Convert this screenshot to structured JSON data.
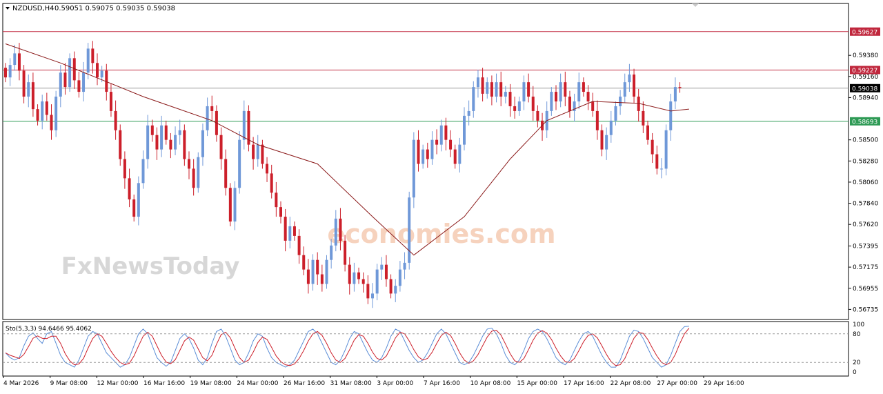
{
  "header": {
    "symbol_label": "NZDUSD,H4",
    "ohlc_label": "0.59051 0.59075 0.59035 0.59038"
  },
  "indicator": {
    "label": "Sto(5,3,3) 94.6466 95.4062",
    "levels": [
      100,
      80,
      20,
      0
    ]
  },
  "watermark": {
    "line1": "economies.com",
    "line2": "FxNewsToday"
  },
  "colors": {
    "bull": "#6f98d8",
    "bear": "#cc1f2a",
    "ma": "#8b1a1a",
    "resistance": "#c0273d",
    "support": "#2e9a55",
    "current": "#9a9a9a",
    "stoch_k": "#5b8dd6",
    "stoch_d": "#cc1f2a",
    "grid": "#000000"
  },
  "chart_data": {
    "type": "candlestick",
    "symbol": "NZDUSD",
    "timeframe": "H4",
    "price_axis_ticks": [
      0.5938,
      0.5916,
      0.5894,
      0.585,
      0.5828,
      0.5806,
      0.5784,
      0.5762,
      0.57395,
      0.57175,
      0.56955,
      0.56735
    ],
    "price_axis_labels": [
      "0.59380",
      "0.59160",
      "0.58940",
      "0.58500",
      "0.58280",
      "0.58060",
      "0.57840",
      "0.57620",
      "0.57395",
      "0.57175",
      "0.56955",
      "0.56735"
    ],
    "ylim": [
      0.5663,
      0.5992
    ],
    "time_axis_labels": [
      "4 Mar 2026",
      "9 Mar 08:00",
      "12 Mar 00:00",
      "16 Mar 16:00",
      "19 Mar 08:00",
      "24 Mar 00:00",
      "26 Mar 16:00",
      "31 Mar 08:00",
      "3 Apr 00:00",
      "7 Apr 16:00",
      "10 Apr 08:00",
      "15 Apr 00:00",
      "17 Apr 16:00",
      "22 Apr 08:00",
      "27 Apr 00:00",
      "29 Apr 16:00"
    ],
    "horizontal_lines": [
      {
        "price": 0.59627,
        "label": "0.59627",
        "role": "resistance"
      },
      {
        "price": 0.59227,
        "label": "0.59227",
        "role": "resistance"
      },
      {
        "price": 0.59038,
        "label": "0.59038",
        "role": "current"
      },
      {
        "price": 0.58693,
        "label": "0.58693",
        "role": "support"
      }
    ],
    "closes": [
      0.5915,
      0.5928,
      0.594,
      0.5922,
      0.5895,
      0.591,
      0.5882,
      0.587,
      0.589,
      0.5876,
      0.586,
      0.5895,
      0.592,
      0.5905,
      0.5935,
      0.5912,
      0.59,
      0.592,
      0.5945,
      0.593,
      0.5915,
      0.5922,
      0.59,
      0.588,
      0.586,
      0.583,
      0.581,
      0.5788,
      0.577,
      0.5805,
      0.583,
      0.5865,
      0.5855,
      0.584,
      0.5865,
      0.585,
      0.584,
      0.5855,
      0.586,
      0.583,
      0.582,
      0.58,
      0.5832,
      0.586,
      0.5885,
      0.588,
      0.5855,
      0.583,
      0.58,
      0.5765,
      0.58,
      0.585,
      0.588,
      0.5845,
      0.583,
      0.5845,
      0.5825,
      0.5815,
      0.5795,
      0.578,
      0.577,
      0.5745,
      0.576,
      0.575,
      0.573,
      0.5715,
      0.57,
      0.5725,
      0.571,
      0.57,
      0.5725,
      0.574,
      0.5768,
      0.5745,
      0.572,
      0.57,
      0.5712,
      0.5705,
      0.57,
      0.5685,
      0.569,
      0.5715,
      0.572,
      0.5705,
      0.569,
      0.5698,
      0.5715,
      0.5722,
      0.579,
      0.585,
      0.5825,
      0.584,
      0.583,
      0.585,
      0.5845,
      0.5865,
      0.585,
      0.584,
      0.5825,
      0.5845,
      0.5875,
      0.588,
      0.5905,
      0.5915,
      0.5898,
      0.591,
      0.5895,
      0.591,
      0.5895,
      0.59,
      0.5885,
      0.588,
      0.589,
      0.591,
      0.5895,
      0.588,
      0.587,
      0.586,
      0.588,
      0.59,
      0.589,
      0.591,
      0.5895,
      0.588,
      0.589,
      0.591,
      0.59,
      0.589,
      0.588,
      0.586,
      0.584,
      0.5855,
      0.587,
      0.5885,
      0.5895,
      0.591,
      0.5918,
      0.5895,
      0.588,
      0.5865,
      0.585,
      0.5835,
      0.582,
      0.582,
      0.586,
      0.589,
      0.5905,
      0.5904
    ],
    "moving_average": [
      {
        "x": 0,
        "y": 0.595
      },
      {
        "x": 12,
        "y": 0.593
      },
      {
        "x": 30,
        "y": 0.5895
      },
      {
        "x": 45,
        "y": 0.587
      },
      {
        "x": 55,
        "y": 0.5845
      },
      {
        "x": 68,
        "y": 0.5825
      },
      {
        "x": 80,
        "y": 0.577
      },
      {
        "x": 89,
        "y": 0.573
      },
      {
        "x": 100,
        "y": 0.577
      },
      {
        "x": 110,
        "y": 0.583
      },
      {
        "x": 118,
        "y": 0.587
      },
      {
        "x": 128,
        "y": 0.589
      },
      {
        "x": 138,
        "y": 0.5888
      },
      {
        "x": 145,
        "y": 0.588
      },
      {
        "x": 149,
        "y": 0.5882
      }
    ],
    "stochastic": {
      "k_last": 94.6466,
      "d_last": 95.4062,
      "k": [
        40,
        30,
        25,
        30,
        55,
        75,
        82,
        70,
        60,
        80,
        85,
        60,
        35,
        20,
        15,
        10,
        25,
        50,
        75,
        85,
        80,
        60,
        40,
        30,
        20,
        10,
        15,
        30,
        55,
        80,
        90,
        80,
        55,
        30,
        20,
        12,
        20,
        45,
        70,
        80,
        70,
        50,
        25,
        15,
        30,
        60,
        85,
        90,
        75,
        50,
        25,
        15,
        20,
        40,
        65,
        80,
        75,
        50,
        30,
        20,
        15,
        10,
        15,
        25,
        45,
        65,
        85,
        90,
        80,
        60,
        40,
        20,
        15,
        25,
        45,
        70,
        85,
        80,
        60,
        40,
        25,
        20,
        30,
        50,
        75,
        90,
        85,
        65,
        45,
        30,
        20,
        25,
        40,
        60,
        80,
        90,
        80,
        60,
        40,
        20,
        15,
        20,
        35,
        55,
        75,
        90,
        92,
        80,
        60,
        35,
        20,
        15,
        25,
        45,
        70,
        85,
        90,
        85,
        70,
        50,
        30,
        20,
        15,
        25,
        45,
        65,
        80,
        85,
        75,
        55,
        35,
        20,
        10,
        10,
        25,
        50,
        75,
        88,
        85,
        70,
        50,
        30,
        20,
        10,
        15,
        35,
        60,
        85,
        95,
        96
      ]
    }
  }
}
